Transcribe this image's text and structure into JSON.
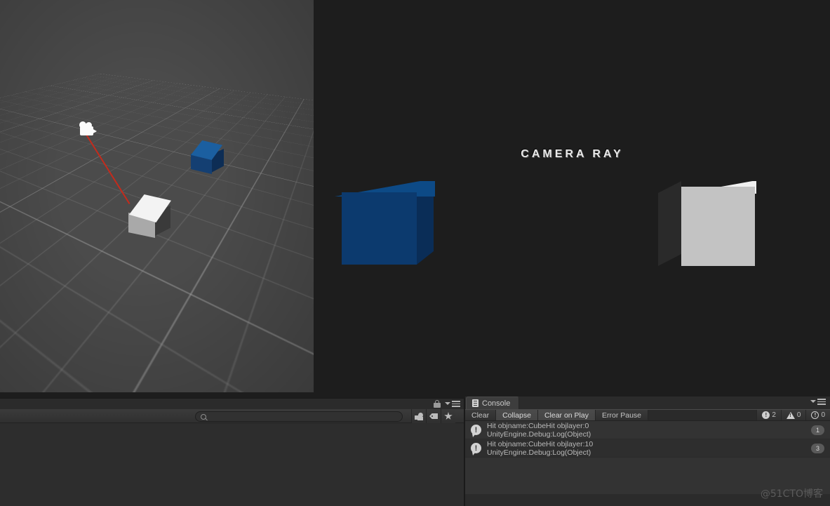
{
  "scene_view": {
    "name": "Scene View",
    "camera_gizmo": "camera-gizmo",
    "ray_color": "#c42b1c",
    "objects": [
      {
        "name": "white-cube",
        "color": "#f3f3f3"
      },
      {
        "name": "blue-cube",
        "color": "#1b5fa0"
      }
    ]
  },
  "game_view": {
    "name": "Game View",
    "title": "CAMERA RAY",
    "background": "#1d1d1d",
    "objects": [
      {
        "name": "blue-cube",
        "color": "#0c3a6e"
      },
      {
        "name": "white-cube",
        "color": "#c3c3c3"
      }
    ]
  },
  "hierarchy": {
    "search": {
      "value": "",
      "placeholder": ""
    },
    "lock_icon": "lock-icon",
    "menu_icon": "panel-menu-icon",
    "filters": [
      {
        "name": "layers-filter",
        "icon": "layers-icon"
      },
      {
        "name": "tag-filter",
        "icon": "tag-icon"
      },
      {
        "name": "favorite-filter",
        "icon": "star-icon"
      }
    ]
  },
  "console": {
    "tab_label": "Console",
    "tab_icon": "console-icon",
    "menu_icon": "panel-menu-icon",
    "toolbar": [
      {
        "label": "Clear",
        "name": "clear-button",
        "active": false
      },
      {
        "label": "Collapse",
        "name": "collapse-button",
        "active": true
      },
      {
        "label": "Clear on Play",
        "name": "clear-on-play-button",
        "active": false
      },
      {
        "label": "Error Pause",
        "name": "error-pause-button",
        "active": false
      }
    ],
    "counters": {
      "errors": "2",
      "warnings": "0",
      "infos": "0",
      "error_glyph": "!",
      "warning_glyph": "!",
      "info_glyph": "!"
    },
    "logs": [
      {
        "icon_glyph": "!",
        "line1": "Hit objname:CubeHit objlayer:0",
        "line2": "UnityEngine.Debug:Log(Object)",
        "count": "1"
      },
      {
        "icon_glyph": "!",
        "line1": "Hit objname:CubeHit objlayer:10",
        "line2": "UnityEngine.Debug:Log(Object)",
        "count": "3"
      }
    ]
  },
  "watermark": {
    "text": "@51CTO博客"
  }
}
